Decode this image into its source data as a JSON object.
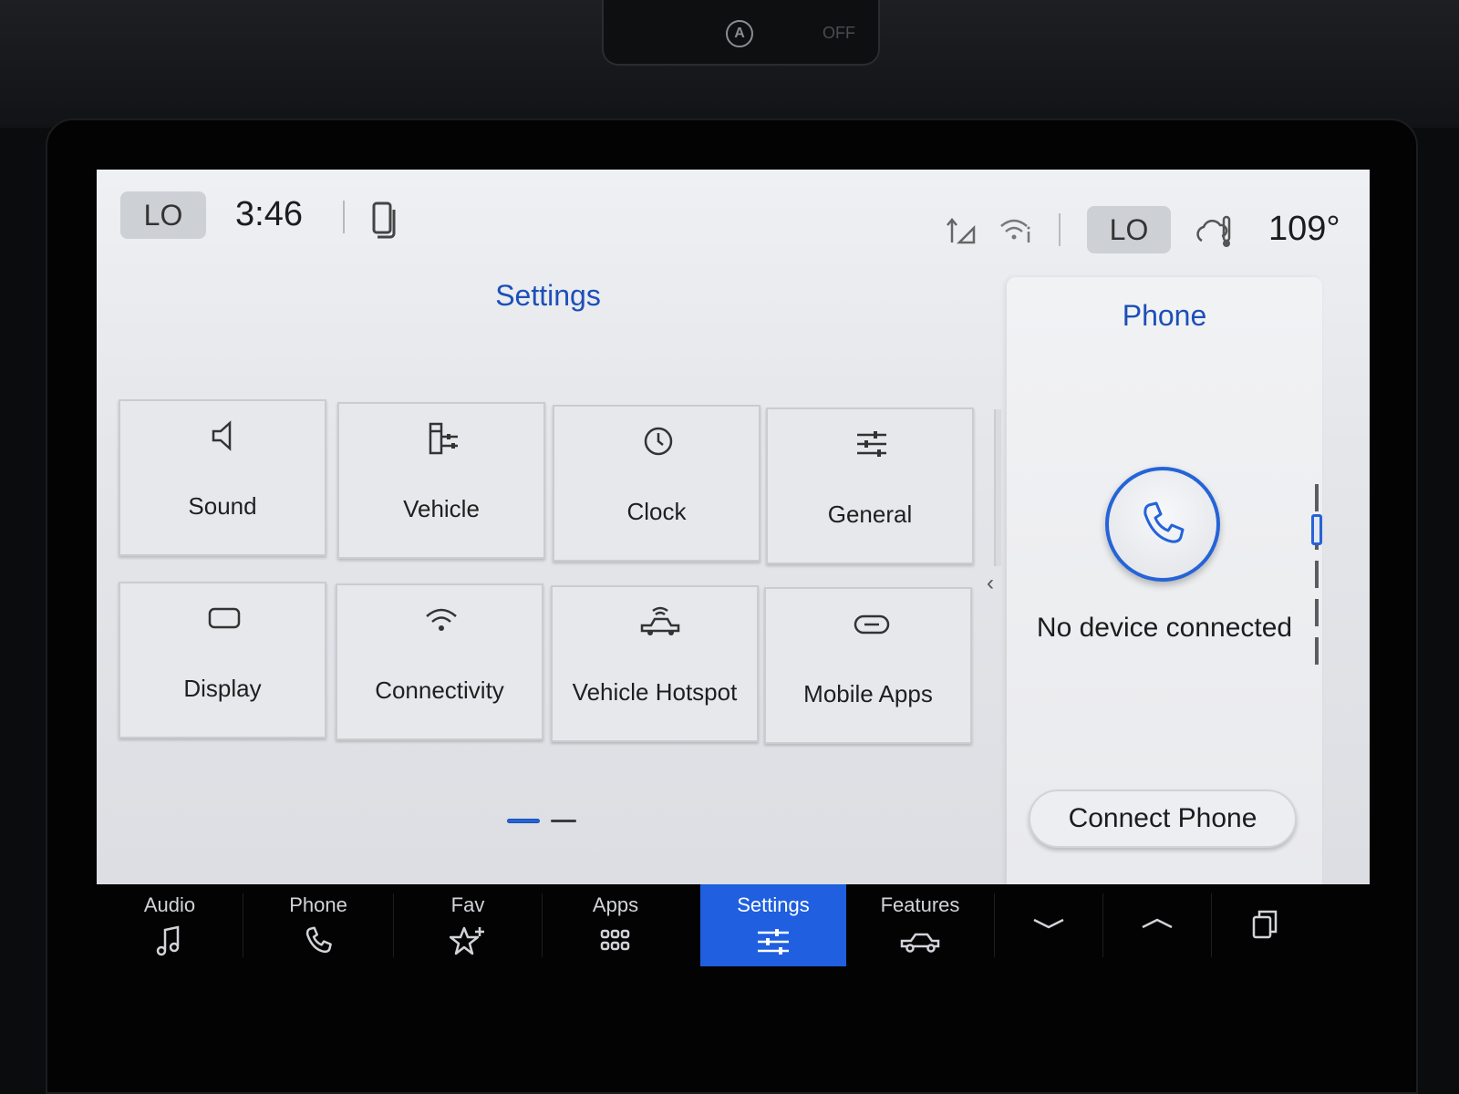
{
  "dashboard": {
    "auto_label": "A",
    "off_label": "OFF"
  },
  "status_bar": {
    "left_climate": "LO",
    "time": "3:46",
    "right_climate": "LO",
    "outside_temp": "109°",
    "icons": [
      "phone-projection-icon",
      "data-arrows-icon",
      "wifi-info-icon",
      "weather-thermometer-icon"
    ]
  },
  "settings": {
    "title": "Settings",
    "tiles": [
      {
        "label": "Sound",
        "icon": "speaker-icon"
      },
      {
        "label": "Vehicle",
        "icon": "vehicle-settings-icon"
      },
      {
        "label": "Clock",
        "icon": "clock-icon"
      },
      {
        "label": "General",
        "icon": "sliders-icon"
      },
      {
        "label": "Display",
        "icon": "display-icon"
      },
      {
        "label": "Connectivity",
        "icon": "wifi-icon"
      },
      {
        "label": "Vehicle Hotspot",
        "icon": "hotspot-icon"
      },
      {
        "label": "Mobile Apps",
        "icon": "link-icon"
      }
    ],
    "page_count": 2,
    "current_page": 1
  },
  "phone_panel": {
    "title": "Phone",
    "status": "No device connected",
    "button": "Connect Phone"
  },
  "nav": {
    "items": [
      {
        "label": "Audio",
        "icon": "music-note-icon"
      },
      {
        "label": "Phone",
        "icon": "phone-icon"
      },
      {
        "label": "Fav",
        "icon": "star-plus-icon"
      },
      {
        "label": "Apps",
        "icon": "apps-grid-icon"
      },
      {
        "label": "Settings",
        "icon": "sliders-icon"
      },
      {
        "label": "Features",
        "icon": "car-icon"
      }
    ],
    "active": "Settings",
    "extra_icons": [
      "chevron-down-icon",
      "chevron-up-icon",
      "copy-icon"
    ]
  },
  "colors": {
    "accent": "#1f5fe0",
    "title_blue": "#1d4fb8"
  }
}
